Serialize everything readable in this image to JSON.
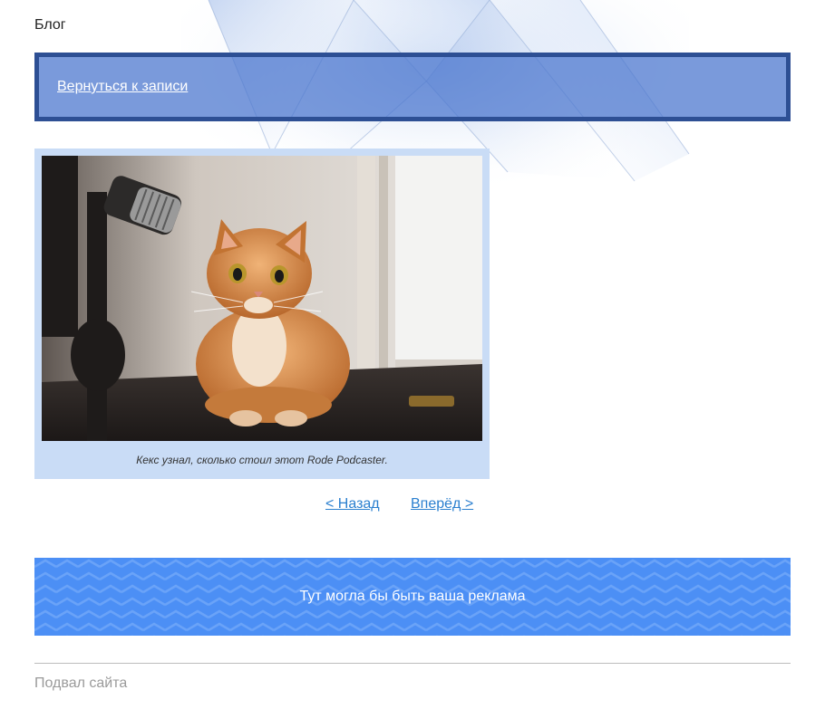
{
  "site": {
    "title": "Блог"
  },
  "back": {
    "label": "Вернуться к записи"
  },
  "figure": {
    "image_alt": "Рыжий кот возле микрофона",
    "caption": "Кекс узнал, сколько стоил этот Rode Podcaster."
  },
  "pagination": {
    "prev_label": "< Назад",
    "next_label": "Вперёд >"
  },
  "ad": {
    "text": "Тут могла бы быть ваша реклама"
  },
  "footer": {
    "text": "Подвал сайта"
  },
  "colors": {
    "accent": "#2d4f94",
    "link": "#2a7fcf",
    "ad_background": "#4c8ff5",
    "figure_background": "#c9dcf6"
  }
}
